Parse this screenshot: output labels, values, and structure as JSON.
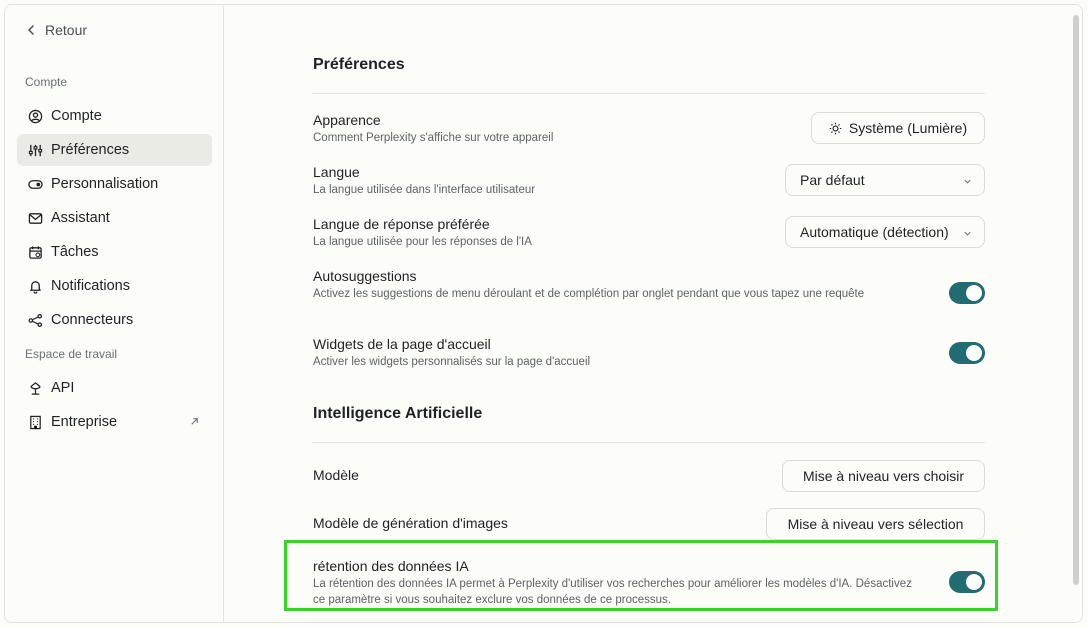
{
  "sidebar": {
    "back_label": "Retour",
    "section_account": "Compte",
    "section_workspace": "Espace de travail",
    "items": [
      {
        "label": "Compte",
        "icon": "user-circle-icon"
      },
      {
        "label": "Préférences",
        "icon": "sliders-icon"
      },
      {
        "label": "Personnalisation",
        "icon": "toggle-icon"
      },
      {
        "label": "Assistant",
        "icon": "mail-icon"
      },
      {
        "label": "Tâches",
        "icon": "calendar-icon"
      },
      {
        "label": "Notifications",
        "icon": "bell-icon"
      },
      {
        "label": "Connecteurs",
        "icon": "share-nodes-icon"
      },
      {
        "label": "API",
        "icon": "api-icon"
      },
      {
        "label": "Entreprise",
        "icon": "building-icon"
      }
    ]
  },
  "preferences": {
    "heading": "Préférences",
    "appearance": {
      "title": "Apparence",
      "desc": "Comment Perplexity s'affiche sur votre appareil",
      "value": "Système (Lumière)"
    },
    "language": {
      "title": "Langue",
      "desc": "La langue utilisée dans l'interface utilisateur",
      "value": "Par défaut"
    },
    "response_language": {
      "title": "Langue de réponse préférée",
      "desc": "La langue utilisée pour les réponses de l'IA",
      "value": "Automatique (détection)"
    },
    "autosuggest": {
      "title": "Autosuggestions",
      "desc": "Activez les suggestions de menu déroulant et de complétion par onglet pendant que vous tapez une requête",
      "enabled": true
    },
    "widgets": {
      "title": "Widgets de la page d'accueil",
      "desc": "Activer les widgets personnalisés sur la page d'accueil",
      "enabled": true
    }
  },
  "ai": {
    "heading": "Intelligence Artificielle",
    "model": {
      "title": "Modèle",
      "button": "Mise à niveau vers choisir"
    },
    "image_model": {
      "title": "Modèle de génération d'images",
      "button": "Mise à niveau vers sélection"
    },
    "retention": {
      "title": "rétention des données IA",
      "desc": "La rétention des données IA permet à Perplexity d'utiliser vos recherches pour améliorer les modèles d'IA. Désactivez ce paramètre si vous souhaitez exclure vos données de ce processus.",
      "enabled": true
    }
  },
  "colors": {
    "accent": "#216b73",
    "highlight": "#39d32b"
  }
}
